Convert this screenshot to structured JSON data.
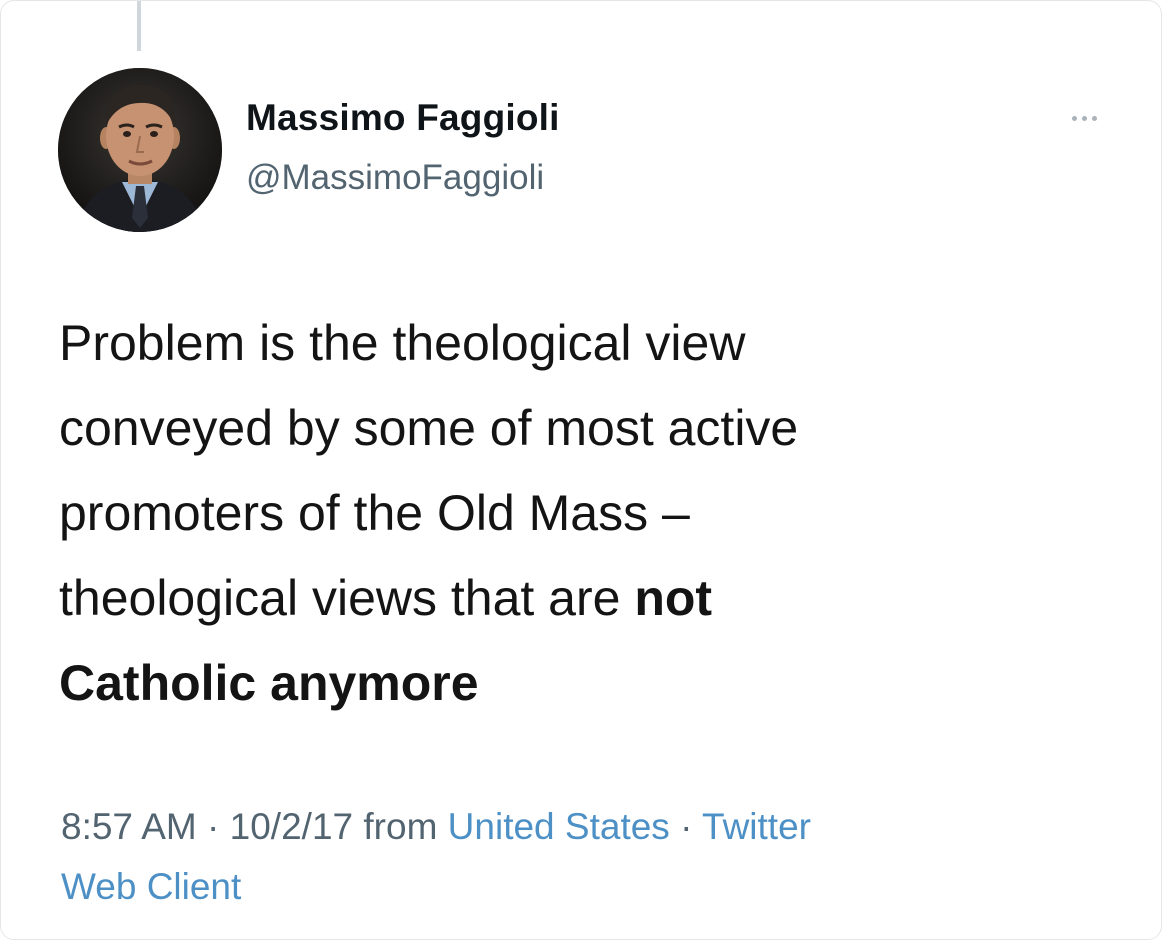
{
  "author": {
    "name": "Massimo Faggioli",
    "handle": "@MassimoFaggioli"
  },
  "icons": {
    "more": "more-horizontal-icon"
  },
  "tweet": {
    "text_normal_1": "Problem is the theological view",
    "text_normal_2": "conveyed by some of most active",
    "text_normal_3": "promoters of the Old Mass –",
    "text_normal_4": "theological views that are ",
    "text_bold_4": "not",
    "text_bold_5": "Catholic anymore"
  },
  "meta": {
    "time": "8:57 AM",
    "sep1": " · ",
    "date": "10/2/17",
    "from": " from ",
    "location": "United States",
    "sep2": " · ",
    "client_part1": "Twitter",
    "client_part2": "Web Client"
  },
  "colors": {
    "text": "#0f1419",
    "secondary": "#536471",
    "link": "#4d90c6",
    "thread_line": "#cfd6dc"
  }
}
